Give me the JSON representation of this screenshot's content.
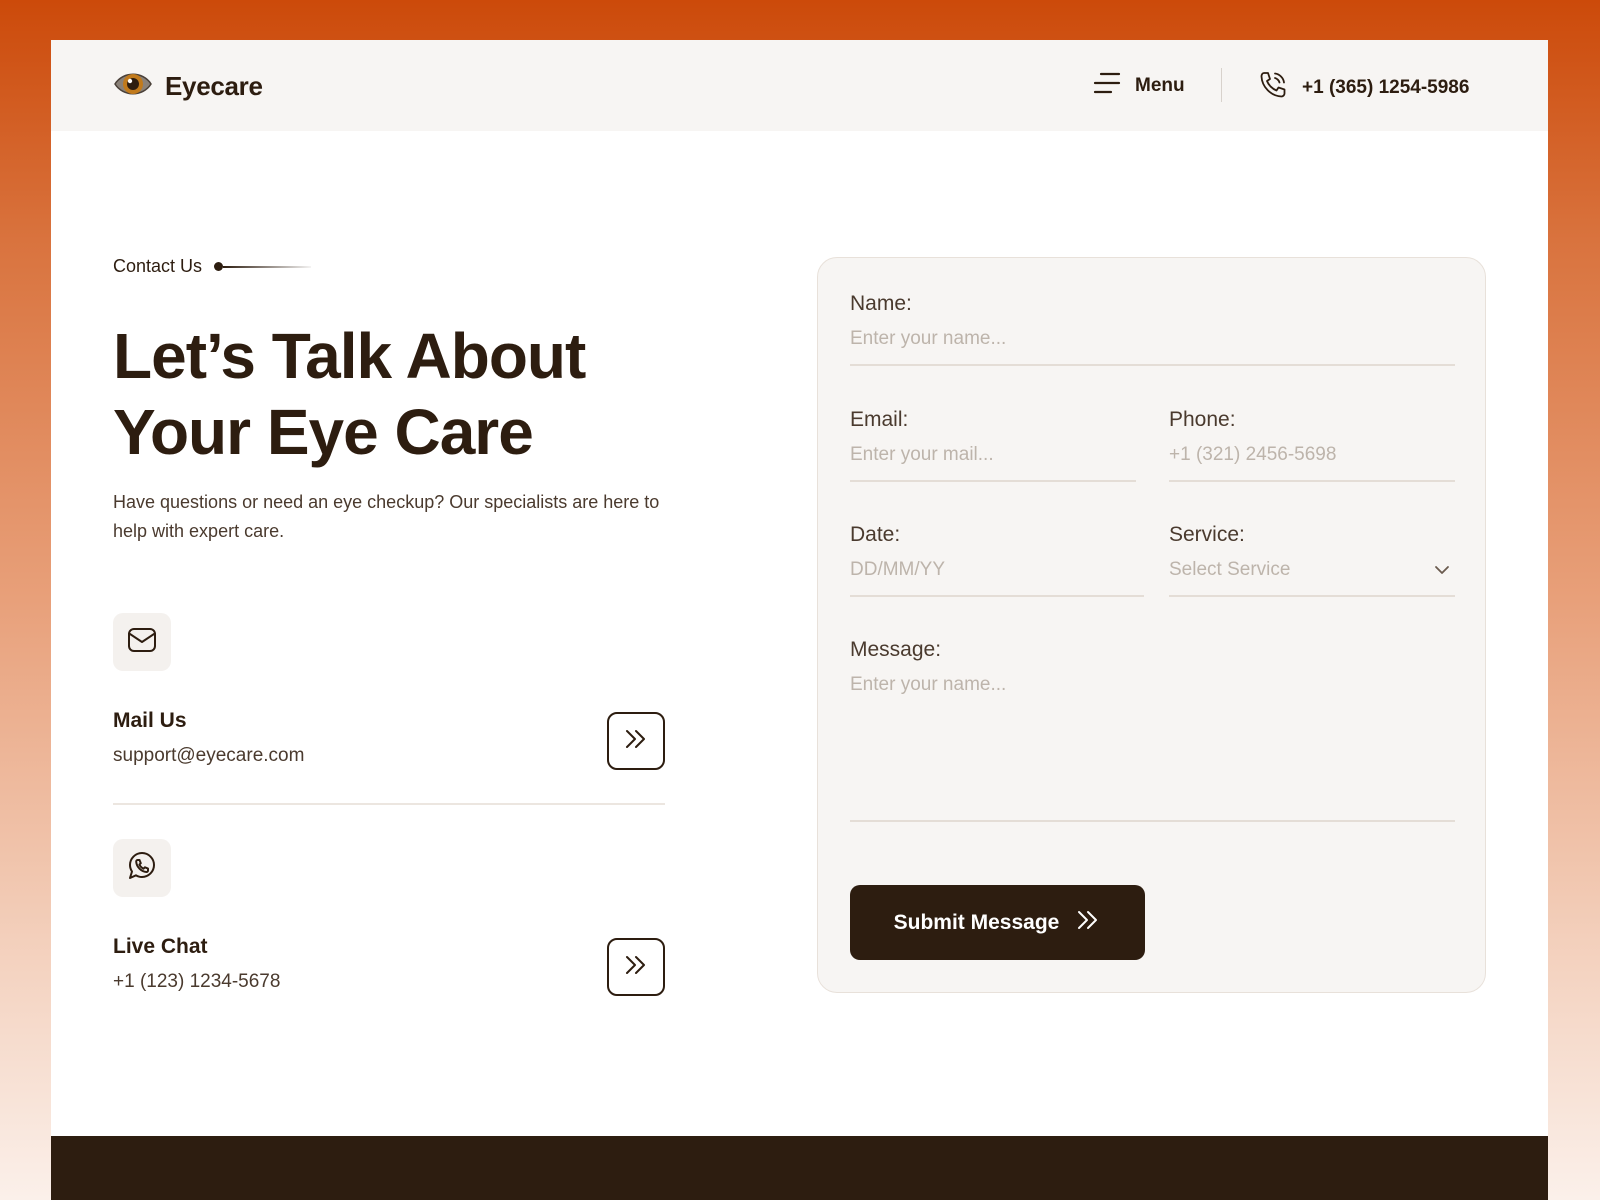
{
  "header": {
    "brand": "Eyecare",
    "menu_label": "Menu",
    "phone": "+1 (365) 1254-5986"
  },
  "hero": {
    "eyebrow": "Contact Us",
    "headline_line1": "Let’s Talk About",
    "headline_line2": "Your Eye Care",
    "subtext": "Have questions or need an eye checkup? Our specialists are here to help with expert care."
  },
  "contacts": [
    {
      "title": "Mail Us",
      "value": "support@eyecare.com",
      "icon": "mail-icon"
    },
    {
      "title": "Live Chat",
      "value": "+1 (123) 1234-5678",
      "icon": "whatsapp-icon"
    }
  ],
  "form": {
    "name_label": "Name:",
    "name_placeholder": "Enter your name...",
    "email_label": "Email:",
    "email_placeholder": "Enter your mail...",
    "phone_label": "Phone:",
    "phone_placeholder": "+1 (321) 2456-5698",
    "date_label": "Date:",
    "date_placeholder": "DD/MM/YY",
    "service_label": "Service:",
    "service_value": "Select Service",
    "message_label": "Message:",
    "message_placeholder": "Enter your name...",
    "submit_label": "Submit Message"
  },
  "colors": {
    "brand_dark": "#2d1d10",
    "accent_orange": "#cc4a0a",
    "card_bg": "#f7f5f3"
  }
}
